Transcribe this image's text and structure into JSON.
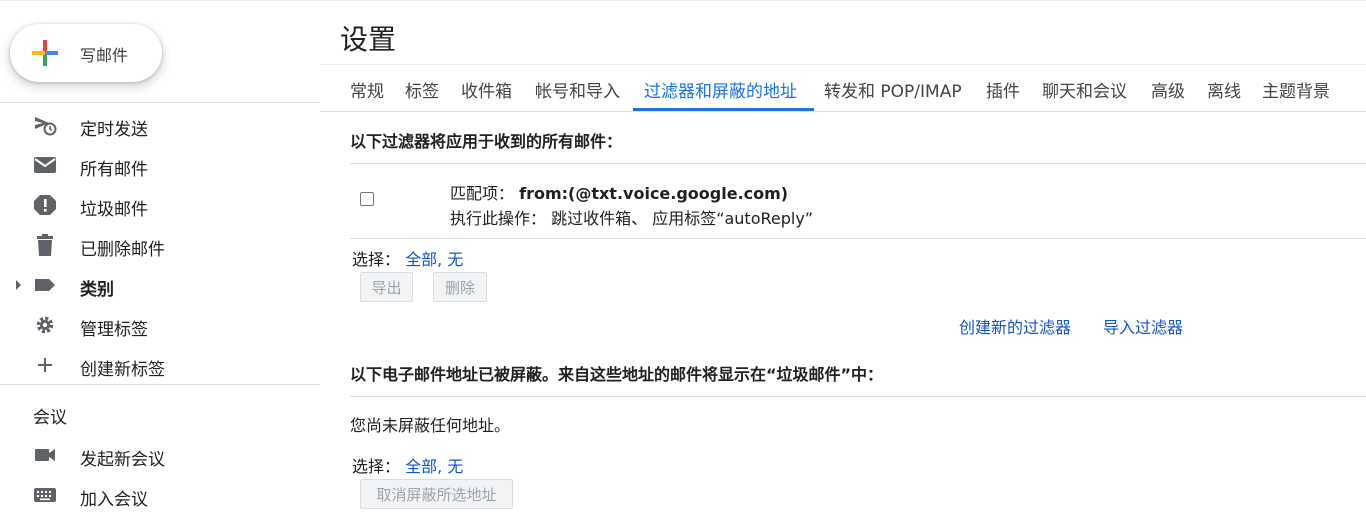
{
  "compose": {
    "label": "写邮件"
  },
  "sidebar": {
    "items": [
      {
        "label": "定时发送",
        "icon": "scheduled-send-icon"
      },
      {
        "label": "所有邮件",
        "icon": "all-mail-icon"
      },
      {
        "label": "垃圾邮件",
        "icon": "spam-icon"
      },
      {
        "label": "已删除邮件",
        "icon": "trash-icon"
      },
      {
        "label": "类别",
        "icon": "label-icon"
      },
      {
        "label": "管理标签",
        "icon": "gear-icon"
      },
      {
        "label": "创建新标签",
        "icon": "plus-icon"
      }
    ],
    "meet_section": "会议",
    "meet_items": [
      {
        "label": "发起新会议",
        "icon": "video-icon"
      },
      {
        "label": "加入会议",
        "icon": "keyboard-icon"
      }
    ]
  },
  "main": {
    "title": "设置",
    "tabs": [
      {
        "label": "常规"
      },
      {
        "label": "标签"
      },
      {
        "label": "收件箱"
      },
      {
        "label": "帐号和导入"
      },
      {
        "label": "过滤器和屏蔽的地址"
      },
      {
        "label": "转发和 POP/IMAP"
      },
      {
        "label": "插件"
      },
      {
        "label": "聊天和会议"
      },
      {
        "label": "高级"
      },
      {
        "label": "离线"
      },
      {
        "label": "主题背景"
      }
    ],
    "active_tab": "过滤器和屏蔽的地址",
    "filters": {
      "heading": "以下过滤器将应用于收到的所有邮件：",
      "match_label": "匹配项：",
      "match_value": "from:(@txt.voice.google.com)",
      "action_label": "执行此操作：",
      "action_value": "跳过收件箱、 应用标签“autoReply”",
      "select_label": "选择：",
      "select_all": "全部",
      "select_sep": ",",
      "select_none": "无",
      "export_button": "导出",
      "delete_button": "删除",
      "create_filter": "创建新的过滤器",
      "import_filter": "导入过滤器"
    },
    "blocked": {
      "heading": "以下电子邮件地址已被屏蔽。来自这些地址的邮件将显示在“垃圾邮件”中：",
      "empty_text": "您尚未屏蔽任何地址。",
      "select_label": "选择：",
      "select_all": "全部",
      "select_sep": ",",
      "select_none": "无",
      "unblock_button": "取消屏蔽所选地址"
    }
  },
  "colors": {
    "accent": "#1a73e8",
    "link": "#1155cc",
    "icon": "#5f6368"
  }
}
